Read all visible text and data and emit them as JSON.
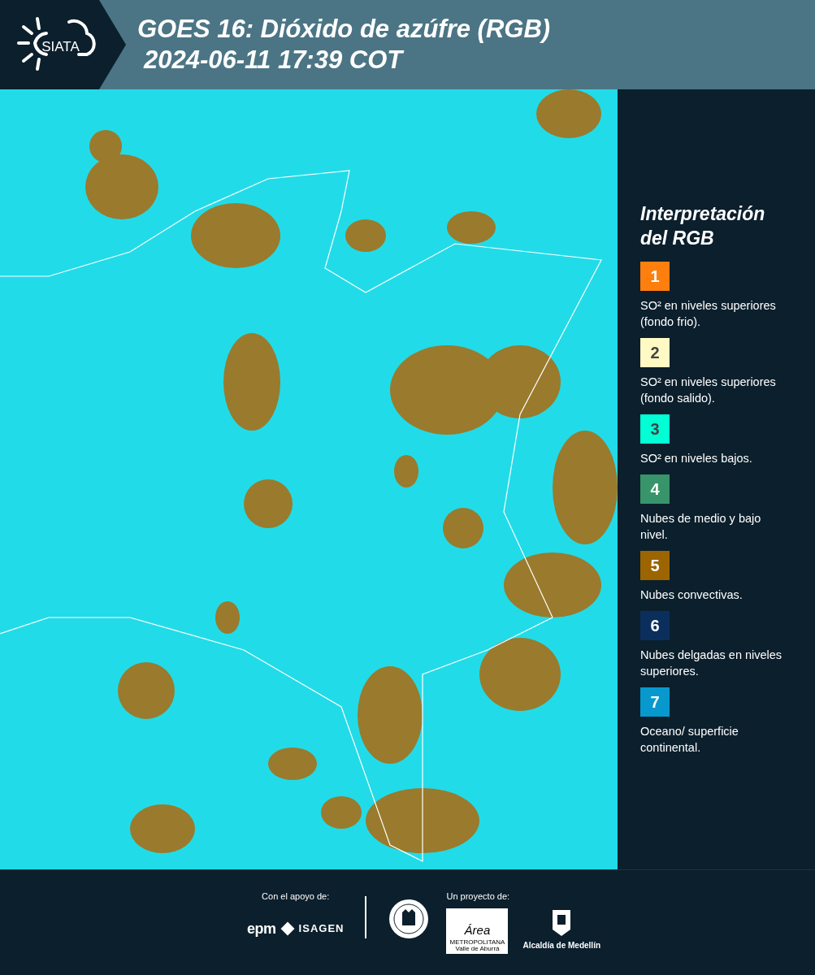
{
  "header": {
    "logo_text": "SIATA",
    "title": "GOES 16: Dióxido de azúfre (RGB)",
    "timestamp": "2024-06-11 17:39 COT"
  },
  "legend": {
    "title": "Interpretación del RGB",
    "items": [
      {
        "number": "1",
        "color": "#ff7f0e",
        "text": "SO² en niveles superiores (fondo frio)."
      },
      {
        "number": "2",
        "color": "#fff9c4",
        "text": "SO² en niveles superiores (fondo salido)."
      },
      {
        "number": "3",
        "color": "#00ffd5",
        "text": "SO² en niveles bajos."
      },
      {
        "number": "4",
        "color": "#38946a",
        "text": "Nubes de medio y bajo nivel."
      },
      {
        "number": "5",
        "color": "#9c6500",
        "text": "Nubes convectivas."
      },
      {
        "number": "6",
        "color": "#0a2f5c",
        "text": "Nubes delgadas en niveles superiores."
      },
      {
        "number": "7",
        "color": "#0799cd",
        "text": "Oceano/ superficie continental."
      }
    ]
  },
  "footer": {
    "support_label": "Con el apoyo de:",
    "support_logos": [
      "epm",
      "ISAGEN"
    ],
    "project_label": "Un proyecto de:",
    "area_logo": {
      "title": "Área",
      "line_1": "METROPOLITANA",
      "line_2": "Valle de Aburrá"
    },
    "city_logo": "Alcaldía de Medellín"
  }
}
